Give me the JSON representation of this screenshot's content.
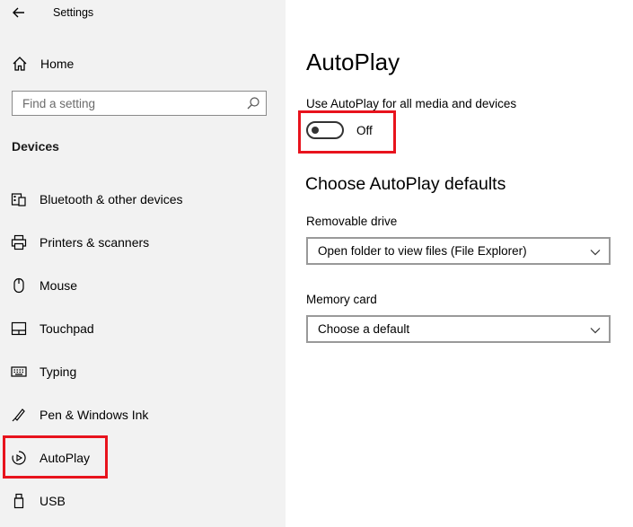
{
  "app": {
    "title": "Settings"
  },
  "sidebar": {
    "home_label": "Home",
    "search_placeholder": "Find a setting",
    "section_title": "Devices",
    "items": [
      {
        "label": "Bluetooth & other devices",
        "icon": "bluetooth-devices-icon"
      },
      {
        "label": "Printers & scanners",
        "icon": "printer-icon"
      },
      {
        "label": "Mouse",
        "icon": "mouse-icon"
      },
      {
        "label": "Touchpad",
        "icon": "touchpad-icon"
      },
      {
        "label": "Typing",
        "icon": "keyboard-icon"
      },
      {
        "label": "Pen & Windows Ink",
        "icon": "pen-icon"
      },
      {
        "label": "AutoPlay",
        "icon": "autoplay-icon",
        "selected": true
      },
      {
        "label": "USB",
        "icon": "usb-icon"
      }
    ]
  },
  "main": {
    "title": "AutoPlay",
    "toggle_label": "Use AutoPlay for all media and devices",
    "toggle_state": "Off",
    "section_title": "Choose AutoPlay defaults",
    "removable_drive": {
      "label": "Removable drive",
      "value": "Open folder to view files (File Explorer)"
    },
    "memory_card": {
      "label": "Memory card",
      "value": "Choose a default"
    }
  },
  "colors": {
    "sidebar_bg": "#f2f2f2",
    "highlight": "#e8131d"
  }
}
